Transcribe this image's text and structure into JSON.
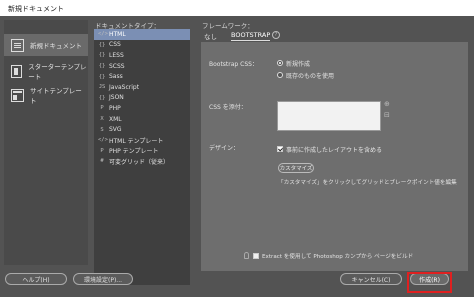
{
  "window": {
    "title": "新規ドキュメント"
  },
  "sidebar": {
    "items": [
      {
        "label": "新規ドキュメント",
        "icon": "document-icon",
        "selected": true
      },
      {
        "label": "スターターテンプレート",
        "icon": "starter-template-icon",
        "selected": false
      },
      {
        "label": "サイトテンプレート",
        "icon": "site-template-icon",
        "selected": false
      }
    ]
  },
  "doc_types": {
    "header": "ドキュメントタイプ：",
    "items": [
      {
        "label": "HTML",
        "glyph": "</>",
        "selected": true
      },
      {
        "label": "CSS",
        "glyph": "{}",
        "selected": false
      },
      {
        "label": "LESS",
        "glyph": "{}",
        "selected": false
      },
      {
        "label": "SCSS",
        "glyph": "{}",
        "selected": false
      },
      {
        "label": "Sass",
        "glyph": "{}",
        "selected": false
      },
      {
        "label": "JavaScript",
        "glyph": "JS",
        "selected": false
      },
      {
        "label": "JSON",
        "glyph": "{}",
        "selected": false
      },
      {
        "label": "PHP",
        "glyph": "P",
        "selected": false
      },
      {
        "label": "XML",
        "glyph": "X",
        "selected": false
      },
      {
        "label": "SVG",
        "glyph": "S",
        "selected": false
      },
      {
        "label": "HTML テンプレート",
        "glyph": "</>",
        "selected": false
      },
      {
        "label": "PHP テンプレート",
        "glyph": "P",
        "selected": false
      },
      {
        "label": "可変グリッド（従来）",
        "glyph": "#",
        "selected": false
      }
    ]
  },
  "framework": {
    "header": "フレームワーク：",
    "tabs": [
      {
        "label": "なし",
        "active": false
      },
      {
        "label": "BOOTSTRAP",
        "active": true
      }
    ],
    "help_glyph": "?",
    "bootstrap_css_label": "Bootstrap CSS：",
    "radio_new": "新規作成",
    "radio_existing": "既存のものを使用",
    "css_attach_label": "CSS を添付：",
    "design_label": "デザイン：",
    "responsive_check": "事前に作成したレイアウトを含める",
    "customize_button": "カスタマイズ",
    "customize_hint": "「カスタマイズ」をクリックしてグリッドとブレークポイント値を編集",
    "extract_check": "Extract を使用して Photoshop カンプから ページをビルド"
  },
  "footer": {
    "help": "ヘルプ(H)",
    "prefs": "環境設定(P)...",
    "cancel": "キャンセル(C)",
    "create": "作成(R)"
  },
  "colors": {
    "highlight": "#e02020",
    "selected_row": "#7b8fb4"
  }
}
